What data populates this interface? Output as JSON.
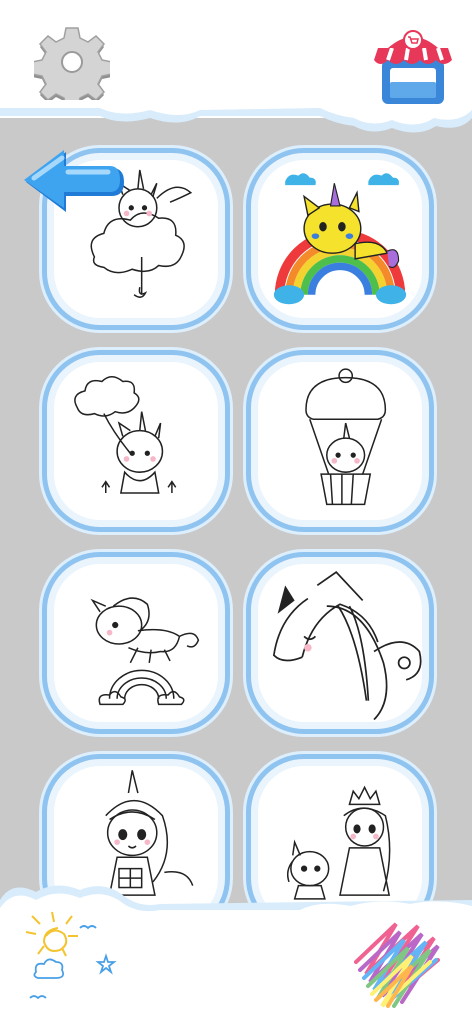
{
  "theme": {
    "grid_background": "#c9c9c9",
    "card_border": "#8fc3f0",
    "cloud_fill": "#ffffff",
    "cloud_shadow": "#d8ecfb"
  },
  "toolbar": {
    "settings_icon": "gear-icon",
    "store_icon": "shop-icon",
    "back_icon": "back-arrow-icon"
  },
  "gallery": {
    "items": [
      {
        "name": "unicorn-cat-on-cloud",
        "colored": false
      },
      {
        "name": "unicorn-cat-on-rainbow",
        "colored": true
      },
      {
        "name": "unicorn-cat-with-balloon",
        "colored": false
      },
      {
        "name": "unicorn-in-cupcake-balloon",
        "colored": false
      },
      {
        "name": "unicorn-jumping-rainbow",
        "colored": false
      },
      {
        "name": "unicorn-closeup",
        "colored": false
      },
      {
        "name": "unicorn-girl-with-gift",
        "colored": false
      },
      {
        "name": "princess-with-unicorn",
        "colored": false
      }
    ]
  },
  "decorations": {
    "bottom_left": "sun-doodle-icon",
    "bottom_right": "rainbow-scribble-icon"
  }
}
